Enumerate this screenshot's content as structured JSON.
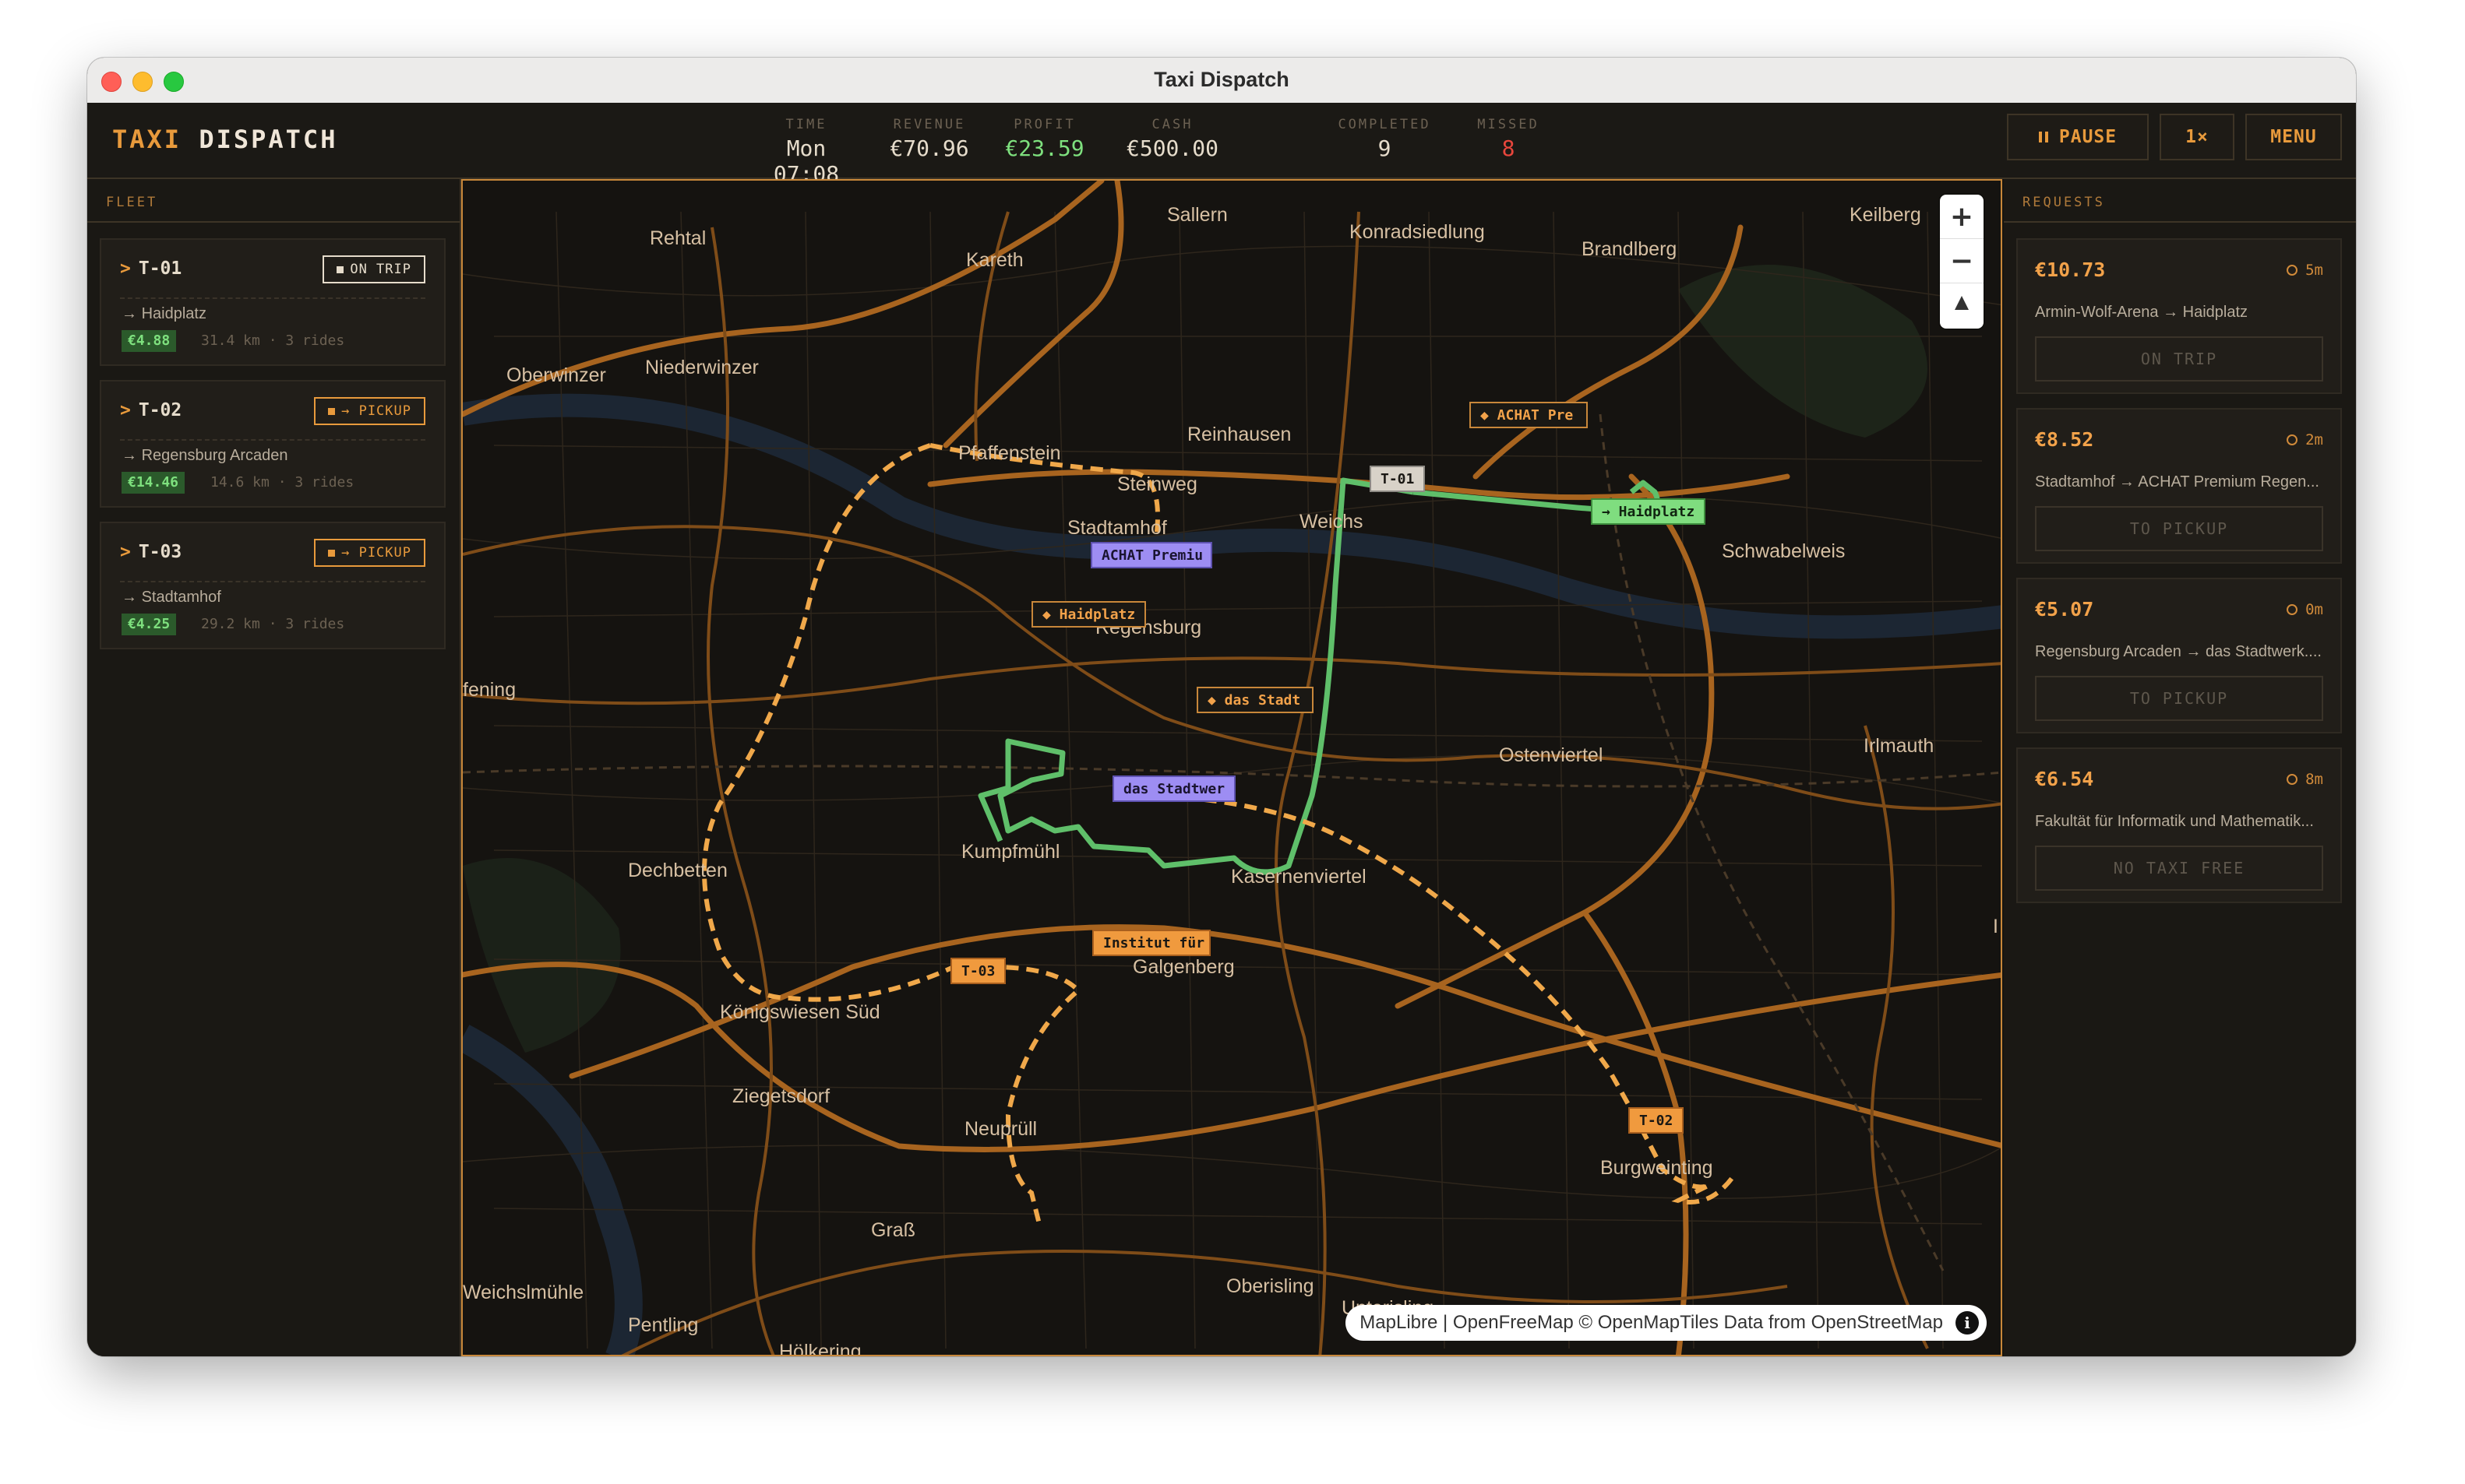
{
  "window": {
    "title": "Taxi Dispatch"
  },
  "brand": {
    "part1": "TAXI",
    "part2": "DISPATCH"
  },
  "stats": {
    "time": {
      "label": "TIME",
      "value": "Mon 07:08"
    },
    "revenue": {
      "label": "REVENUE",
      "value": "€70.96"
    },
    "profit": {
      "label": "PROFIT",
      "value": "€23.59"
    },
    "cash": {
      "label": "CASH",
      "value": "€500.00"
    },
    "completed": {
      "label": "COMPLETED",
      "value": "9"
    },
    "missed": {
      "label": "MISSED",
      "value": "8"
    }
  },
  "controls": {
    "pause": "PAUSE",
    "speed": "1×",
    "menu": "MENU"
  },
  "fleet": {
    "header": "FLEET",
    "taxis": [
      {
        "id": "T-01",
        "status": "ON TRIP",
        "destination": "Haidplatz",
        "earnings": "€4.88",
        "meta": "31.4 km · 3 rides"
      },
      {
        "id": "T-02",
        "status": "→ PICKUP",
        "destination": "Regensburg Arcaden",
        "earnings": "€14.46",
        "meta": "14.6 km · 3 rides"
      },
      {
        "id": "T-03",
        "status": "→ PICKUP",
        "destination": "Stadtamhof",
        "earnings": "€4.25",
        "meta": "29.2 km · 3 rides"
      }
    ]
  },
  "map": {
    "places": {
      "rehtal": "Rehtal",
      "kareth": "Kareth",
      "sallern": "Sallern",
      "konradsiedlung": "Konradsiedlung",
      "brandlberg": "Brandlberg",
      "keilberg": "Keilberg",
      "oberwinzer": "Oberwinzer",
      "niederwinzer": "Niederwinzer",
      "reinhausen": "Reinhausen",
      "pfaffenstein": "Pfaffenstein",
      "steinweg": "Steinweg",
      "stadtamhof": "Stadtamhof",
      "weichs": "Weichs",
      "schwabelweis": "Schwabelweis",
      "regensburg": "Regensburg",
      "fening": "fening",
      "ostenviertel": "Ostenviertel",
      "irlmauth": "Irlmauth",
      "dechbetten": "Dechbetten",
      "kumpfmuehl": "Kumpfmühl",
      "kasernenviertel": "Kasernenviertel",
      "galgenberg": "Galgenberg",
      "koenigswiesen": "Königswiesen Süd",
      "ziegetsdorf": "Ziegetsdorf",
      "neupruell": "Neuprüll",
      "burgweinting": "Burgweinting",
      "grass": "Graß",
      "oberisling": "Oberisling",
      "weichslmuehle": "Weichslmühle",
      "unterisling": "Unterisling",
      "pentling": "Pentling",
      "hoelkering": "Hölkering",
      "edge_i": "I"
    },
    "markers": {
      "taxi_t01": "T-01",
      "taxi_t02": "T-02",
      "taxi_t03": "T-03",
      "haidplatz_dropoff": "→ Haidplatz",
      "haidplatz_pickup": "◆ Haidplatz",
      "achat_pickup": "◆ ACHAT Pre",
      "achat_dest": "ACHAT Premiu",
      "stadtwerk_pickup": "◆ das Stadt",
      "stadtwerk_dest": "das Stadtwer",
      "institut": "Institut für"
    },
    "zoom": {
      "in": "+",
      "out": "−"
    },
    "attribution": "MapLibre | OpenFreeMap © OpenMapTiles Data from OpenStreetMap",
    "info_glyph": "i"
  },
  "requests": {
    "header": "REQUESTS",
    "items": [
      {
        "price": "€10.73",
        "wait": "5m",
        "route": "Armin-Wolf-Arena → Haidplatz",
        "action": "ON TRIP"
      },
      {
        "price": "€8.52",
        "wait": "2m",
        "route": "Stadtamhof → ACHAT Premium Regen...",
        "action": "TO PICKUP"
      },
      {
        "price": "€5.07",
        "wait": "0m",
        "route": "Regensburg Arcaden → das Stadtwerk....",
        "action": "TO PICKUP"
      },
      {
        "price": "€6.54",
        "wait": "8m",
        "route": "Fakultät für Informatik und Mathematik...",
        "action": "NO TAXI FREE"
      }
    ]
  },
  "colors": {
    "accent": "#e89a3c",
    "profit": "#7ee07e",
    "missed": "#e8463c",
    "route_active": "#5fbf6a",
    "route_pending": "#f0a84a",
    "road": "#a8641f"
  }
}
